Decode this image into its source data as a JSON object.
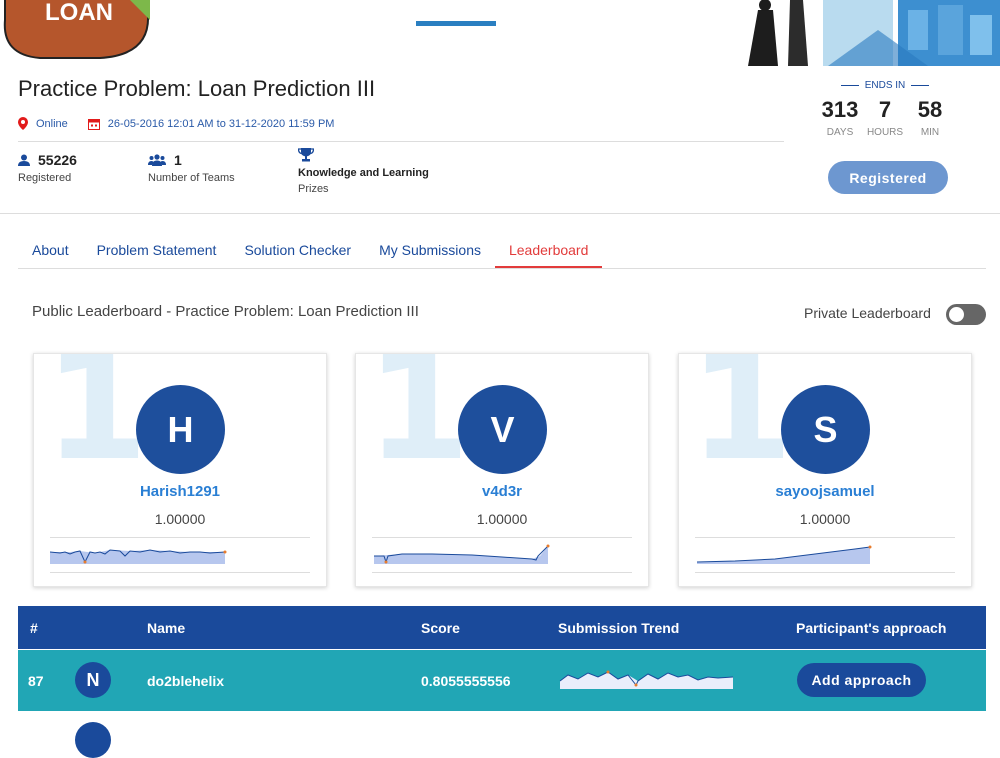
{
  "banner": {
    "logo_text": "LOAN"
  },
  "header": {
    "title": "Practice Problem: Loan Prediction III",
    "location": "Online",
    "dates": "26-05-2016 12:01 AM to 31-12-2020 11:59 PM",
    "stats": [
      {
        "value": "55226",
        "label": "Registered",
        "icon": "user-icon"
      },
      {
        "value": "1",
        "label": "Number of Teams",
        "icon": "team-icon"
      },
      {
        "value": "Knowledge and Learning",
        "label": "Prizes",
        "icon": "trophy-icon"
      }
    ],
    "ends_in": {
      "label": "ENDS IN",
      "days": "313",
      "hours": "7",
      "min": "58",
      "days_label": "DAYS",
      "hours_label": "HOURS",
      "min_label": "MIN"
    },
    "registered_button": "Registered"
  },
  "tabs": [
    "About",
    "Problem Statement",
    "Solution Checker",
    "My Submissions",
    "Leaderboard"
  ],
  "active_tab": "Leaderboard",
  "leaderboard": {
    "title": "Public Leaderboard - Practice Problem: Loan Prediction III",
    "private_label": "Private Leaderboard",
    "private_on": false,
    "top": [
      {
        "rank": "1",
        "initial": "H",
        "name": "Harish1291",
        "score": "1.00000"
      },
      {
        "rank": "1",
        "initial": "V",
        "name": "v4d3r",
        "score": "1.00000"
      },
      {
        "rank": "1",
        "initial": "S",
        "name": "sayoojsamuel",
        "score": "1.00000"
      }
    ],
    "columns": [
      "#",
      "Name",
      "Score",
      "Submission Trend",
      "Participant's approach"
    ],
    "rows": [
      {
        "rank": "87",
        "initial": "N",
        "name": "do2blehelix",
        "score": "0.8055555556",
        "action": "Add approach"
      }
    ]
  },
  "colors": {
    "primary": "#1a4a9b",
    "accent": "#e23b3b",
    "row": "#21a6b5",
    "link": "#2a7fd4"
  }
}
